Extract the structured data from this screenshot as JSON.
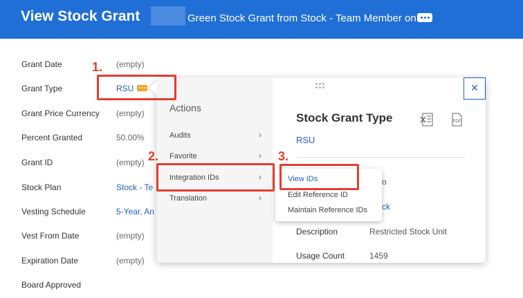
{
  "header": {
    "title": "View Stock Grant",
    "subtitle": "Green Stock Grant from Stock - Team Member on",
    "more_icon": "ellipsis-icon"
  },
  "fields": [
    {
      "label": "Grant Date",
      "value": "(empty)"
    },
    {
      "label": "Grant Type",
      "value": "RSU"
    },
    {
      "label": "Grant Price Currency",
      "value": "(empty)"
    },
    {
      "label": "Percent Granted",
      "value": "50.00%"
    },
    {
      "label": "Grant ID",
      "value": "(empty)"
    },
    {
      "label": "Stock Plan",
      "value": "Stock - Te"
    },
    {
      "label": "Vesting Schedule",
      "value": "5-Year, An"
    },
    {
      "label": "Vest From Date",
      "value": "(empty)"
    },
    {
      "label": "Expiration Date",
      "value": "(empty)"
    },
    {
      "label": "Board Approved",
      "value": ""
    }
  ],
  "annotations": {
    "step1": "1.",
    "step2": "2.",
    "step3": "3."
  },
  "popup": {
    "actions_title": "Actions",
    "actions": [
      {
        "label": "Audits"
      },
      {
        "label": "Favorite"
      },
      {
        "label": "Integration IDs"
      },
      {
        "label": "Translation"
      }
    ],
    "chevron": "›",
    "close_label": "×",
    "detail": {
      "title": "Stock Grant Type",
      "link": "RSU",
      "partial_1": "o",
      "partial_2": "ck",
      "rows": [
        {
          "label": "Description",
          "value": "Restricted Stock Unit"
        },
        {
          "label": "Usage Count",
          "value": "1459"
        }
      ],
      "excel_icon": "excel-export-icon",
      "pdf_icon": "pdf-export-icon",
      "pdf_text": "PDF"
    },
    "submenu": [
      {
        "label": "View IDs"
      },
      {
        "label": "Edit Reference ID"
      },
      {
        "label": "Maintain Reference IDs"
      }
    ]
  },
  "colors": {
    "header_bg": "#1f6fd6",
    "link": "#1f5fbf",
    "annotation": "#e53d2f",
    "chip": "#f2a623"
  }
}
